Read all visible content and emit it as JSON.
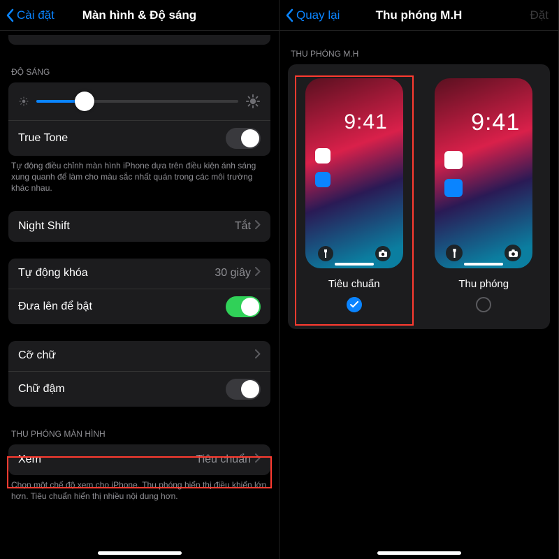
{
  "colors": {
    "accent": "#0a84ff",
    "green": "#30d158",
    "red": "#ff3b30"
  },
  "left": {
    "nav": {
      "back": "Cài đặt",
      "title": "Màn hình & Độ sáng"
    },
    "brightness": {
      "header": "ĐỘ SÁNG",
      "slider_value_pct": 24,
      "truetone_label": "True Tone",
      "truetone_on": false,
      "truetone_footer": "Tự động điều chỉnh màn hình iPhone dựa trên điều kiện ánh sáng xung quanh để làm cho màu sắc nhất quán trong các môi trường khác nhau."
    },
    "nightshift": {
      "label": "Night Shift",
      "value": "Tắt"
    },
    "autolock": {
      "label": "Tự động khóa",
      "value": "30 giây"
    },
    "raise": {
      "label": "Đưa lên để bật",
      "on": true
    },
    "textsize": {
      "label": "Cỡ chữ"
    },
    "bold": {
      "label": "Chữ đậm",
      "on": false
    },
    "zoom": {
      "header": "THU PHÓNG MÀN HÌNH",
      "view_label": "Xem",
      "view_value": "Tiêu chuẩn",
      "footer": "Chọn một chế độ xem cho iPhone. Thu phóng hiển thị điều khiển lớn hơn. Tiêu chuẩn hiển thị nhiều nội dung hơn."
    }
  },
  "right": {
    "nav": {
      "back": "Quay lại",
      "title": "Thu phóng M.H",
      "done": "Đặt"
    },
    "header": "THU PHÓNG M.H",
    "preview_time": "9:41",
    "options": [
      {
        "label": "Tiêu chuẩn",
        "selected": true
      },
      {
        "label": "Thu phóng",
        "selected": false
      }
    ]
  }
}
